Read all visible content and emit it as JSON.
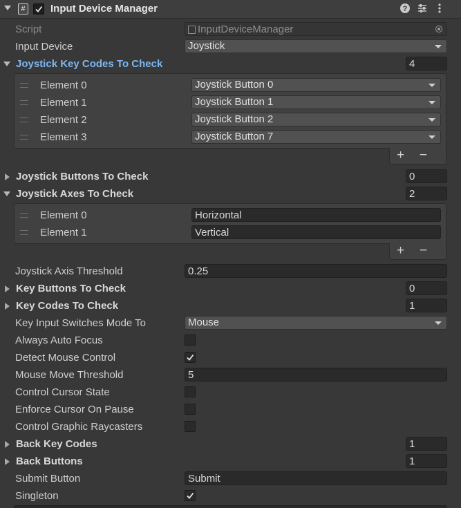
{
  "component": {
    "title": "Input Device Manager",
    "script_glyph": "#",
    "enabled": true,
    "icons": [
      "help-icon",
      "preset-icon",
      "kebab-menu-icon"
    ]
  },
  "script_row": {
    "label": "Script",
    "value": "InputDeviceManager"
  },
  "input_device": {
    "label": "Input Device",
    "value": "Joystick"
  },
  "joystick_key_codes": {
    "label": "Joystick Key Codes To Check",
    "size": "4",
    "elements": [
      {
        "label": "Element 0",
        "value": "Joystick Button 0"
      },
      {
        "label": "Element 1",
        "value": "Joystick Button 1"
      },
      {
        "label": "Element 2",
        "value": "Joystick Button 2"
      },
      {
        "label": "Element 3",
        "value": "Joystick Button 7"
      }
    ]
  },
  "joystick_buttons": {
    "label": "Joystick Buttons To Check",
    "size": "0"
  },
  "joystick_axes": {
    "label": "Joystick Axes To Check",
    "size": "2",
    "elements": [
      {
        "label": "Element 0",
        "value": "Horizontal"
      },
      {
        "label": "Element 1",
        "value": "Vertical"
      }
    ]
  },
  "list_footer": {
    "plus": "+",
    "minus": "−"
  },
  "joystick_axis_threshold": {
    "label": "Joystick Axis Threshold",
    "value": "0.25"
  },
  "key_buttons": {
    "label": "Key Buttons To Check",
    "size": "0"
  },
  "key_codes": {
    "label": "Key Codes To Check",
    "size": "1"
  },
  "key_input_switches": {
    "label": "Key Input Switches Mode To",
    "value": "Mouse"
  },
  "always_auto_focus": {
    "label": "Always Auto Focus",
    "checked": false
  },
  "detect_mouse_control": {
    "label": "Detect Mouse Control",
    "checked": true
  },
  "mouse_move_threshold": {
    "label": "Mouse Move Threshold",
    "value": "5"
  },
  "control_cursor_state": {
    "label": "Control Cursor State",
    "checked": false
  },
  "enforce_cursor_on_pause": {
    "label": "Enforce Cursor On Pause",
    "checked": false
  },
  "control_graphic_raycasters": {
    "label": "Control Graphic Raycasters",
    "checked": false
  },
  "back_key_codes": {
    "label": "Back Key Codes",
    "size": "1"
  },
  "back_buttons": {
    "label": "Back Buttons",
    "size": "1"
  },
  "submit_button": {
    "label": "Submit Button",
    "value": "Submit"
  },
  "singleton": {
    "label": "Singleton",
    "checked": true
  },
  "colors": {
    "background": "#383838",
    "header": "#3e3e3e",
    "field": "#2a2a2a",
    "dropdown": "#515151",
    "accent_label": "#7cb7f5",
    "text": "#d2d2d2"
  }
}
